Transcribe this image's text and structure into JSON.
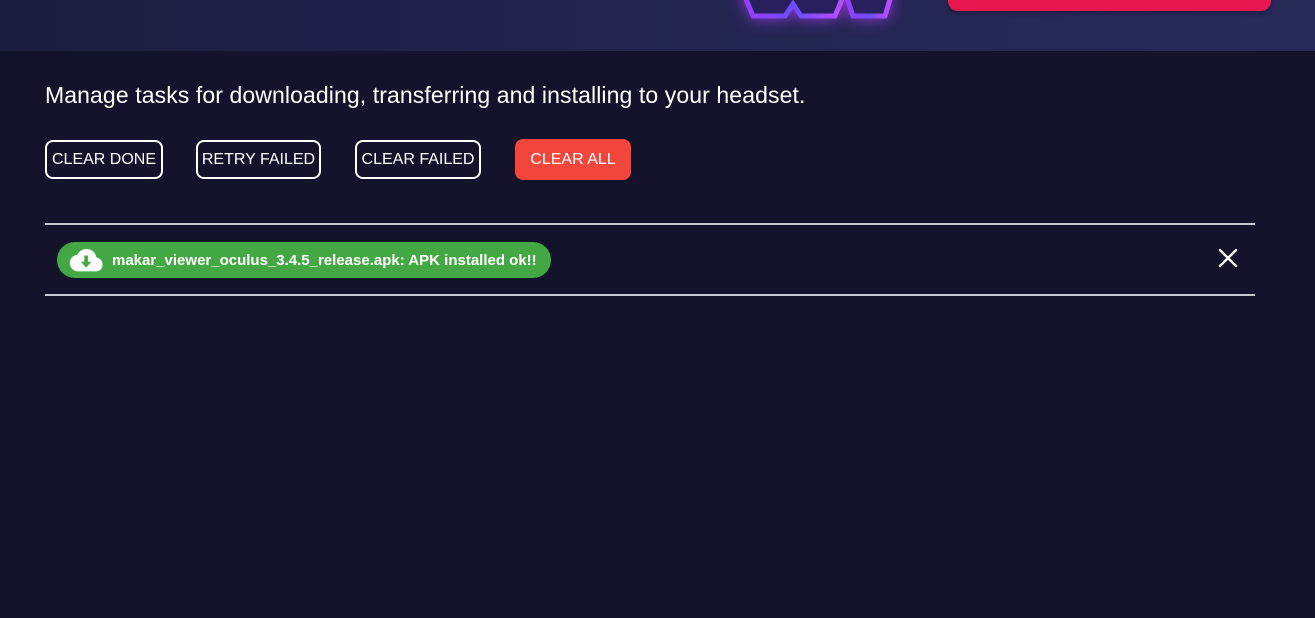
{
  "header": {
    "logo_icon": "vr-headset-logo-icon",
    "cta_color": "#e8174f"
  },
  "main": {
    "description": "Manage tasks for downloading, transferring and installing to your headset.",
    "actions": {
      "clear_done": "CLEAR DONE",
      "retry_failed": "RETRY FAILED",
      "clear_failed": "CLEAR FAILED",
      "clear_all": "CLEAR ALL"
    },
    "tasks": [
      {
        "status": "success",
        "status_color": "#43a843",
        "icon": "cloud-download-icon",
        "text": "makar_viewer_oculus_3.4.5_release.apk: APK installed ok!!",
        "dismiss_icon": "close-icon"
      }
    ]
  },
  "colors": {
    "background": "#13142b",
    "danger": "#f2453c",
    "success": "#43a843"
  }
}
